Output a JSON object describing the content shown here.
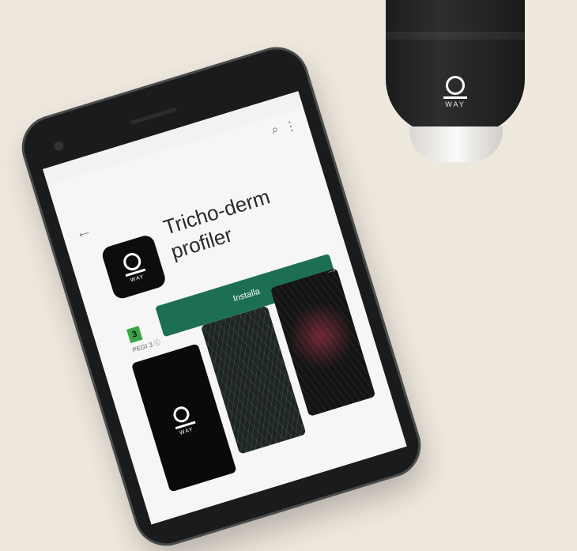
{
  "app": {
    "title": "Tricho-derm\nprofiler",
    "icon_label": "WAY",
    "rating_badge": "3",
    "rating_label": "PEGI 3 ⓘ",
    "install_label": "Installa"
  },
  "screenshots": [
    {
      "kind": "logo",
      "label": "WAY"
    },
    {
      "kind": "hair"
    },
    {
      "kind": "red"
    }
  ],
  "device": {
    "logo_text": "WAY"
  },
  "icons": {
    "back": "arrow-left-icon",
    "search": "search-icon",
    "more": "more-vertical-icon",
    "next": "arrow-right-icon"
  },
  "colors": {
    "install": "#1d6f52",
    "pegi": "#3aa545",
    "phone": "#1a1b1c",
    "background": "#efe8de"
  }
}
